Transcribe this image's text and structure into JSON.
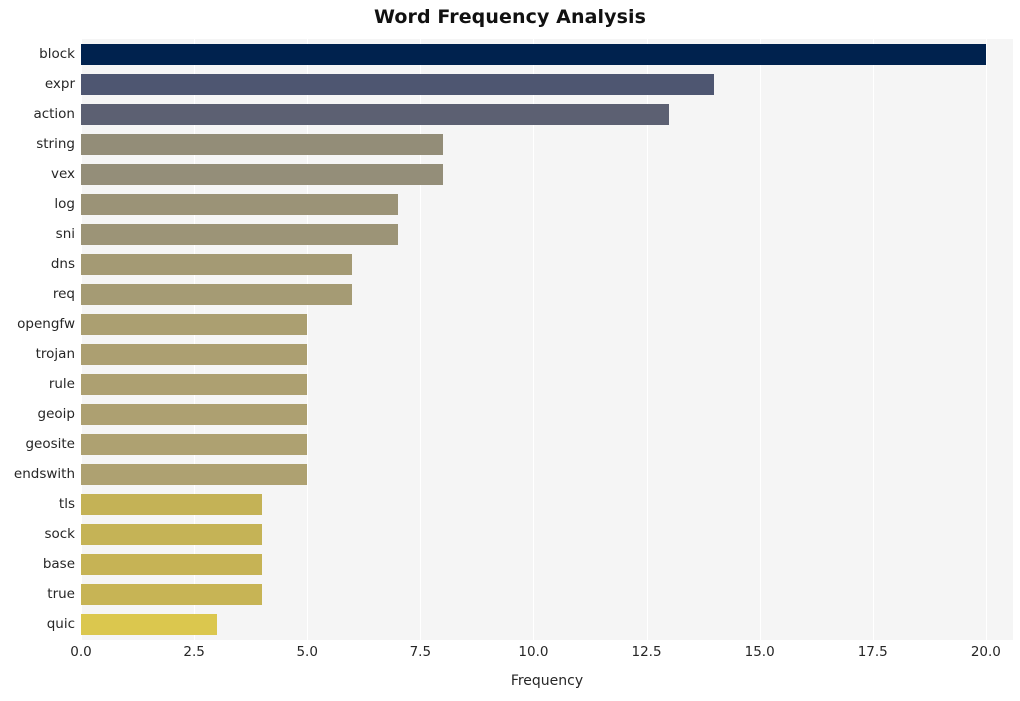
{
  "chart_data": {
    "type": "bar",
    "orientation": "horizontal",
    "title": "Word Frequency Analysis",
    "xlabel": "Frequency",
    "ylabel": "",
    "categories": [
      "block",
      "expr",
      "action",
      "string",
      "vex",
      "log",
      "sni",
      "dns",
      "req",
      "opengfw",
      "trojan",
      "rule",
      "geoip",
      "geosite",
      "endswith",
      "tls",
      "sock",
      "base",
      "true",
      "quic"
    ],
    "values": [
      20,
      14,
      13,
      8,
      8,
      7,
      7,
      6,
      6,
      5,
      5,
      5,
      5,
      5,
      5,
      4,
      4,
      4,
      4,
      3
    ],
    "xlim": [
      0,
      20.6
    ],
    "xticks": [
      0,
      2.5,
      5,
      7.5,
      10,
      12.5,
      15,
      17.5,
      20
    ],
    "xtick_labels": [
      "0.0",
      "2.5",
      "5.0",
      "7.5",
      "10.0",
      "12.5",
      "15.0",
      "17.5",
      "20.0"
    ],
    "grid": "vertical-white",
    "legend": "none",
    "bar_colors": [
      "#00224e",
      "#4e5671",
      "#5c6072",
      "#938d78",
      "#948e79",
      "#9b9377",
      "#9c9477",
      "#a49a74",
      "#a59b74",
      "#ab9f71",
      "#ac9f71",
      "#ada071",
      "#ada071",
      "#aea171",
      "#aea171",
      "#c4b256",
      "#c5b356",
      "#c6b355",
      "#c7b455",
      "#dbc74e"
    ],
    "plot_background": "#f5f5f5",
    "figure_background": "#ffffff",
    "gridline_color": "#ffffff",
    "tick_text_color": "#262626"
  }
}
